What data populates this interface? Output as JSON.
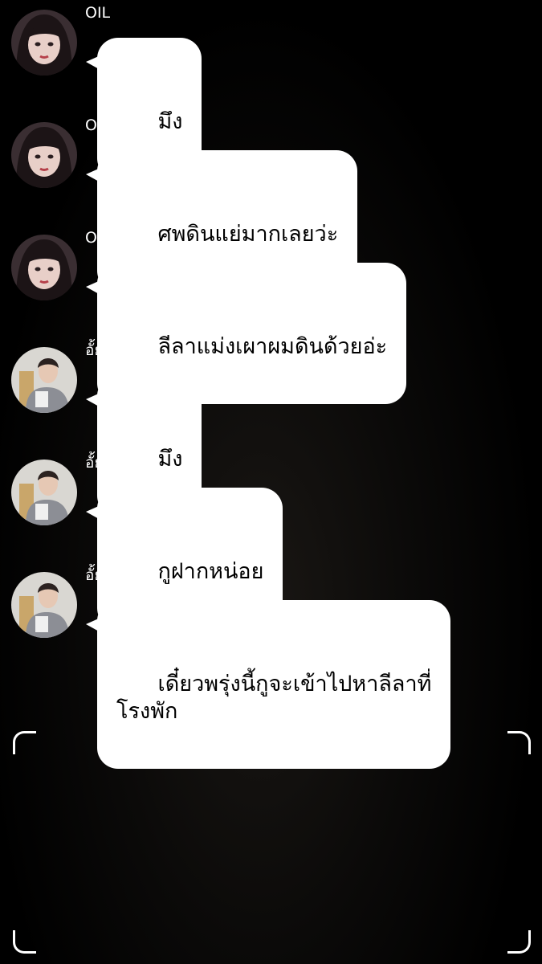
{
  "messages": [
    {
      "sender": "OIL",
      "avatar": "girl-avatar",
      "text": "มึง"
    },
    {
      "sender": "OIL",
      "avatar": "girl-avatar",
      "text": "ศพดินแย่มากเลยว่ะ"
    },
    {
      "sender": "OIL",
      "avatar": "girl-avatar",
      "text": "ลีลาแม่งเผาผมดินด้วยอ่ะ"
    },
    {
      "sender": "อั้ย",
      "avatar": "boy-avatar",
      "text": "มึง"
    },
    {
      "sender": "อั้ย",
      "avatar": "boy-avatar",
      "text": "กูฝากหน่อย"
    },
    {
      "sender": "อั้ย",
      "avatar": "boy-avatar",
      "text": "เดี๋ยวพรุ่งนี้กูจะเข้าไปหาลีลาที่\nโรงพัก"
    }
  ],
  "icons": {
    "viewfinder": "viewfinder-corner-icon"
  },
  "colors": {
    "background": "#000000",
    "bubble": "#ffffff",
    "text": "#000000",
    "sender_text": "#ffffff"
  }
}
